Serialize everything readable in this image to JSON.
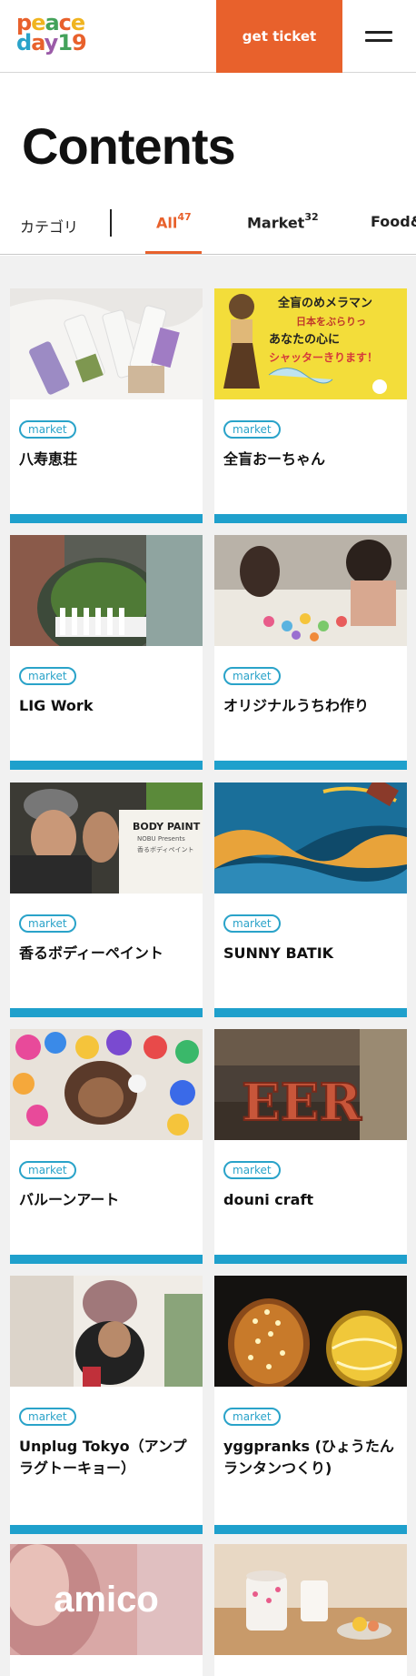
{
  "header": {
    "logo_line1": [
      "p",
      "e",
      "a",
      "c",
      "e"
    ],
    "logo_line2": [
      "d",
      "a",
      "y",
      "1",
      "9"
    ],
    "logo_colors_line1": [
      "#e8612c",
      "#f0b41f",
      "#44a25a",
      "#e8612c",
      "#f0b41f"
    ],
    "logo_colors_line2": [
      "#2aa3c9",
      "#e8612c",
      "#9b5ba8",
      "#44a25a",
      "#e8612c"
    ],
    "ticket_label": "get ticket",
    "menu_icon": "hamburger-icon",
    "accent_color": "#e8612c"
  },
  "page_title": "Contents",
  "categories": {
    "label": "カテゴリ",
    "tabs": [
      {
        "name": "All",
        "count": "47",
        "active": true
      },
      {
        "name": "Market",
        "count": "32",
        "active": false
      },
      {
        "name": "Food&",
        "count": "",
        "active": false
      }
    ]
  },
  "cards": [
    {
      "tag": "market",
      "name": "八寿恵荘"
    },
    {
      "tag": "market",
      "name": "全盲おーちゃん"
    },
    {
      "tag": "market",
      "name": "LIG Work"
    },
    {
      "tag": "market",
      "name": "オリジナルうちわ作り"
    },
    {
      "tag": "market",
      "name": "香るボディーペイント"
    },
    {
      "tag": "market",
      "name": "SUNNY BATIK"
    },
    {
      "tag": "market",
      "name": "バルーンアート"
    },
    {
      "tag": "market",
      "name": "douni craft"
    },
    {
      "tag": "market",
      "name": "Unplug Tokyo（アンプラグトーキョー）"
    },
    {
      "tag": "market",
      "name": "yggpranks (ひょうたんランタンつくり)"
    },
    {
      "tag": "",
      "name": "",
      "overlay": "amico"
    },
    {
      "tag": "",
      "name": ""
    }
  ],
  "thumb_text": {
    "card1_line1": "全盲のめメラマン",
    "card1_line2": "日本をぶらりっ",
    "card1_line3": "あなたの心に",
    "card1_line4": "シャッターきります！",
    "card4_line1": "BODY PAINT",
    "card4_line2": "NOBU Presents",
    "card4_line3": "香るボディペイント",
    "card7_letters": "EER"
  }
}
